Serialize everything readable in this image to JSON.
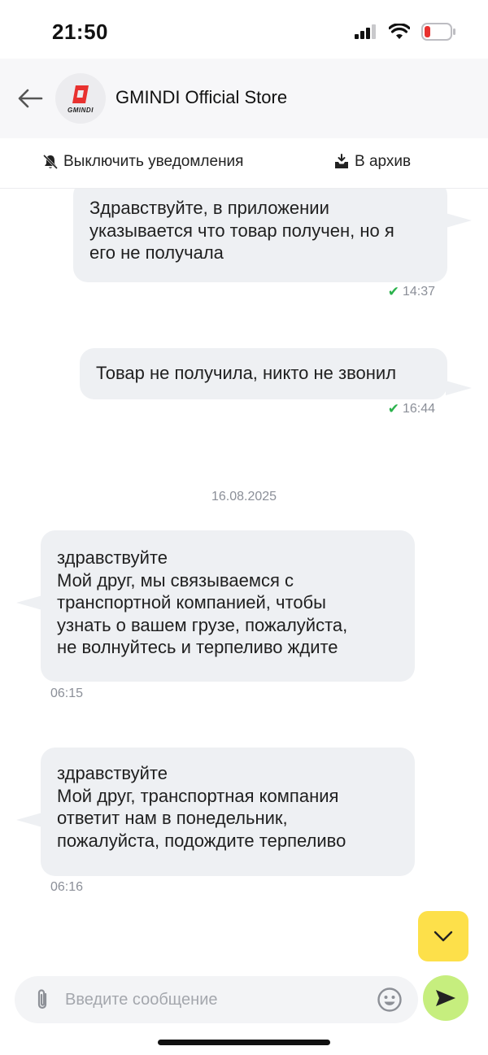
{
  "status_bar": {
    "time": "21:50"
  },
  "header": {
    "title": "GMINDI Official Store",
    "avatar_wordmark": "GMINDI"
  },
  "actions": {
    "mute_label": "Выключить уведомления",
    "archive_label": "В архив"
  },
  "messages": [
    {
      "direction": "outgoing",
      "lines": [
        "Здравствуйте, в приложении",
        "указывается что товар получен, но я",
        "его не получала"
      ],
      "time": "14:37",
      "delivered": true
    },
    {
      "direction": "outgoing",
      "lines": [
        "Товар не получила, никто не звонил"
      ],
      "time": "16:44",
      "delivered": true
    },
    {
      "direction": "incoming",
      "lines": [
        "здравствуйте",
        "Мой друг, мы связываемся с",
        "транспортной компанией, чтобы",
        "узнать о вашем грузе, пожалуйста,",
        "не волнуйтесь и терпеливо ждите"
      ],
      "time": "06:15"
    },
    {
      "direction": "incoming",
      "lines": [
        "здравствуйте",
        "Мой друг, транспортная компания",
        "ответит нам в понедельник,",
        "пожалуйста, подождите терпеливо"
      ],
      "time": "06:16"
    }
  ],
  "date_separator": "16.08.2025",
  "composer": {
    "placeholder": "Введите сообщение",
    "value": ""
  },
  "colors": {
    "bubble": "#eef0f3",
    "check": "#2bb24c",
    "scroll_button": "#fde04a",
    "send_button": "#c6ee7e",
    "brand_red": "#e8312f"
  },
  "icons": {
    "back": "arrow-left-icon",
    "mute": "bell-off-icon",
    "archive": "archive-icon",
    "scroll": "chevron-down-icon",
    "attach": "paperclip-icon",
    "emoji": "smiley-icon",
    "send": "send-icon"
  }
}
